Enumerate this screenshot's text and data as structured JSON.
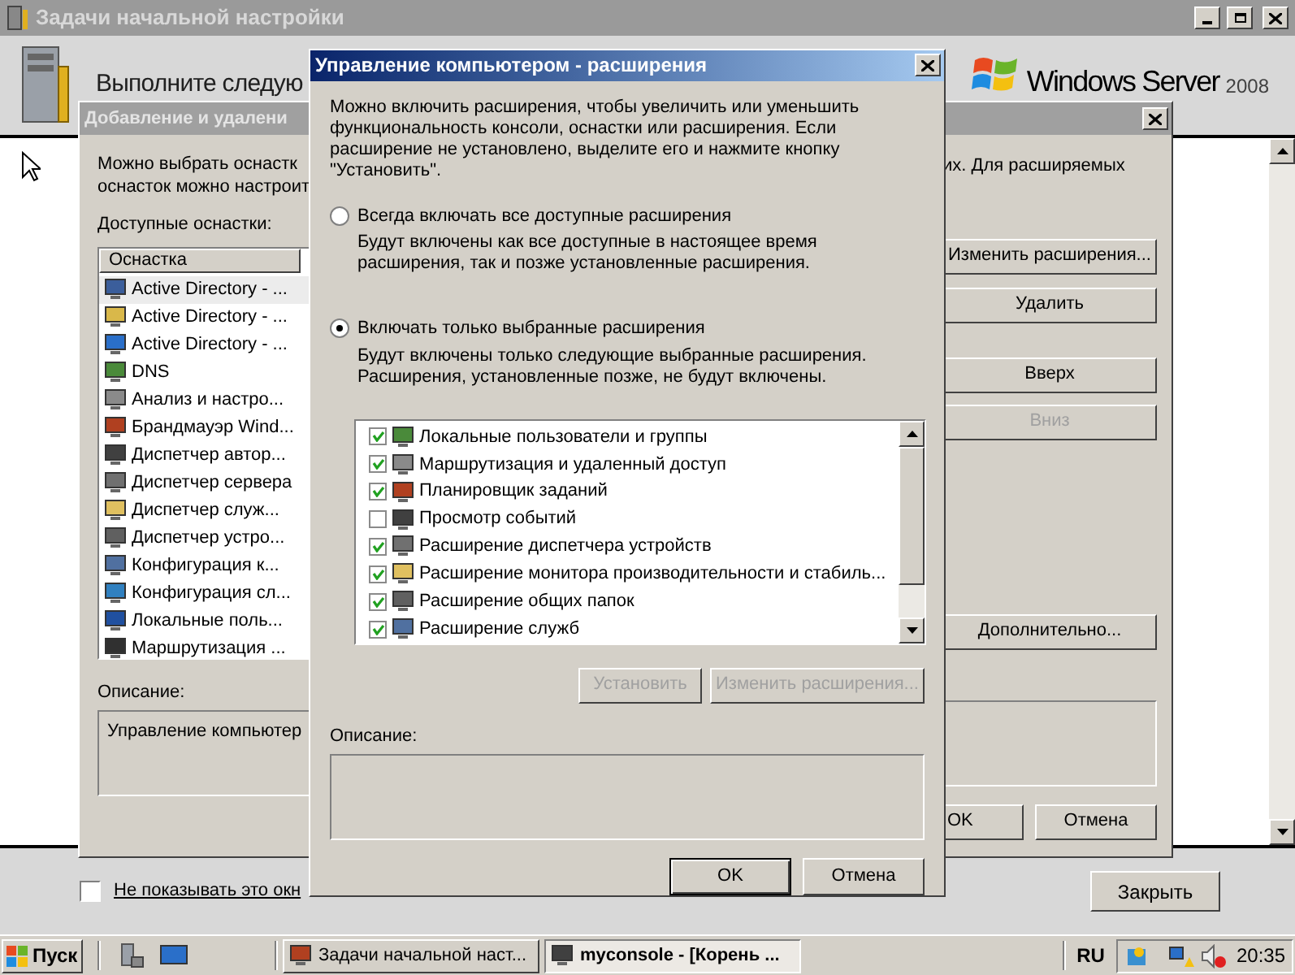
{
  "background_window": {
    "title": "Задачи начальной настройки",
    "heading": "Выполните следую",
    "logo_text": "Windows Server",
    "logo_version": "2008",
    "dont_show": {
      "label": "Не показывать это окн",
      "checked": false
    },
    "close_button": "Закрыть"
  },
  "snapin_dialog": {
    "title": "Добавление и удалени",
    "intro_left": [
      "Можно выбрать оснастк",
      "оснасток можно настроит"
    ],
    "intro_right": "их. Для расширяемых",
    "available_label": "Доступные оснастки:",
    "column": "Оснастка",
    "snapins": [
      {
        "name": "Active Directory - ...",
        "selected": true
      },
      {
        "name": "Active Directory - ...",
        "selected": false
      },
      {
        "name": "Active Directory - ...",
        "selected": false
      },
      {
        "name": "DNS",
        "selected": false
      },
      {
        "name": "Анализ и настро...",
        "selected": false
      },
      {
        "name": "Брандмауэр Wind...",
        "selected": false
      },
      {
        "name": "Диспетчер автор...",
        "selected": false
      },
      {
        "name": "Диспетчер сервера",
        "selected": false
      },
      {
        "name": "Диспетчер служ...",
        "selected": false
      },
      {
        "name": "Диспетчер устро...",
        "selected": false
      },
      {
        "name": "Конфигурация к...",
        "selected": false
      },
      {
        "name": "Конфигурация сл...",
        "selected": false
      },
      {
        "name": "Локальные поль...",
        "selected": false
      },
      {
        "name": "Маршрутизация ...",
        "selected": false
      }
    ],
    "buttons": [
      {
        "label": "Изменить расширения...",
        "disabled": false
      },
      {
        "label": "Удалить",
        "disabled": false
      },
      {
        "label": "Вверх",
        "disabled": false
      },
      {
        "label": "Вниз",
        "disabled": true
      }
    ],
    "advanced_button": "Дополнительно...",
    "description_label": "Описание:",
    "description": "Управление компьютер",
    "ok": "OK",
    "cancel": "Отмена"
  },
  "extensions_dialog": {
    "title": "Управление компьютером - расширения",
    "intro": [
      "Можно включить расширения, чтобы увеличить или уменьшить",
      "функциональность консоли, оснастки или расширения.  Если",
      "расширение не установлено, выделите его и нажмите кнопку",
      "\"Установить\"."
    ],
    "options": [
      {
        "label": "Всегда включать все доступные расширения",
        "description": [
          "Будут включены как все доступные в настоящее время",
          "расширения, так и позже установленные расширения."
        ],
        "selected": false
      },
      {
        "label": "Включать только выбранные расширения",
        "description": [
          "Будут включены только следующие выбранные расширения.",
          "Расширения, установленные позже, не будут включены."
        ],
        "selected": true
      }
    ],
    "extensions": [
      {
        "name": "Локальные пользователи и группы",
        "checked": true
      },
      {
        "name": "Маршрутизация и удаленный доступ",
        "checked": true
      },
      {
        "name": "Планировщик заданий",
        "checked": true
      },
      {
        "name": "Просмотр событий",
        "checked": false
      },
      {
        "name": "Расширение диспетчера устройств",
        "checked": true
      },
      {
        "name": "Расширение монитора производительности и стабиль...",
        "checked": true
      },
      {
        "name": "Расширение общих папок",
        "checked": true
      },
      {
        "name": "Расширение служб",
        "checked": true
      }
    ],
    "install_button": {
      "label": "Установить",
      "disabled": true
    },
    "edit_button": {
      "label": "Изменить расширения...",
      "disabled": true
    },
    "description_label": "Описание:",
    "ok": "OK",
    "cancel": "Отмена"
  },
  "taskbar": {
    "start": "Пуск",
    "tasks": [
      {
        "label": "Задачи начальной наст...",
        "selected": false
      },
      {
        "label": "myconsole - [Корень ...",
        "selected": true
      }
    ],
    "language": "RU",
    "clock": "20:35"
  }
}
